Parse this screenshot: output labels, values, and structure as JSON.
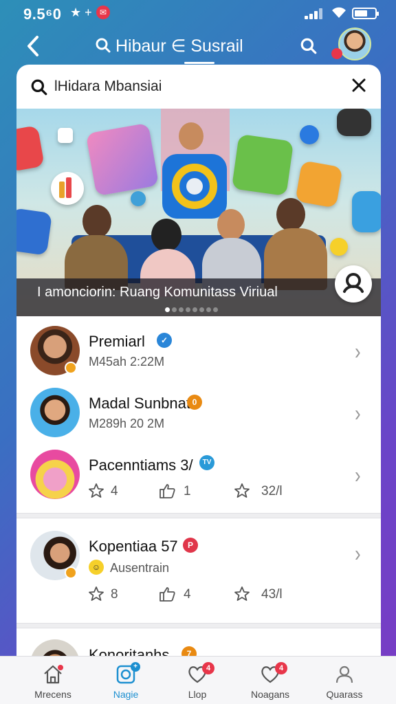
{
  "status_bar": {
    "time": "9.5⁶0",
    "extra": "★ +",
    "notification": "✉"
  },
  "header": {
    "title": "Hibaur ∈ Susrail",
    "back_icon": "back-chevron-icon",
    "search_icon": "search-icon"
  },
  "search": {
    "value": "lHidara Mbansiai",
    "close_icon": "close-icon"
  },
  "banner": {
    "caption": "I amonciorin: Ruang Komunitass Viriual",
    "dots_total": 8,
    "dots_active": 0
  },
  "list": [
    {
      "title": "Premiarl",
      "badge": "✓",
      "badge_color": "#2a86d8",
      "subtitle": "M45ah 2:22M"
    },
    {
      "title": "Madal Sunbnat",
      "badge": "0",
      "badge_color": "#e98a12",
      "subtitle": "M289h 20 2M"
    },
    {
      "title": "Pacenntiams 3/",
      "badge": "TV",
      "badge_color": "#2a9ad8",
      "stats": [
        "4",
        "1",
        "32/l"
      ]
    }
  ],
  "card": {
    "title": "Kopentiaa 57",
    "badge": "P",
    "badge_color": "#e0364a",
    "subtitle": "Ausentrain",
    "stats": [
      "8",
      "4",
      "43/l"
    ]
  },
  "partial_row": {
    "title": "Konoritanhs",
    "badge": "7",
    "badge_color": "#e98a12"
  },
  "bottom_nav": [
    {
      "label": "Mrecens",
      "icon": "home-icon",
      "badge": ""
    },
    {
      "label": "Nagie",
      "icon": "camera-icon",
      "badge": "+"
    },
    {
      "label": "Llop",
      "icon": "heart-icon",
      "badge": "4"
    },
    {
      "label": "Noagans",
      "icon": "heart-icon",
      "badge": "4"
    },
    {
      "label": "Quarass",
      "icon": "profile-icon",
      "badge": ""
    }
  ],
  "colors": {
    "accent": "#1c8fd0",
    "badge_red": "#e8364a"
  }
}
